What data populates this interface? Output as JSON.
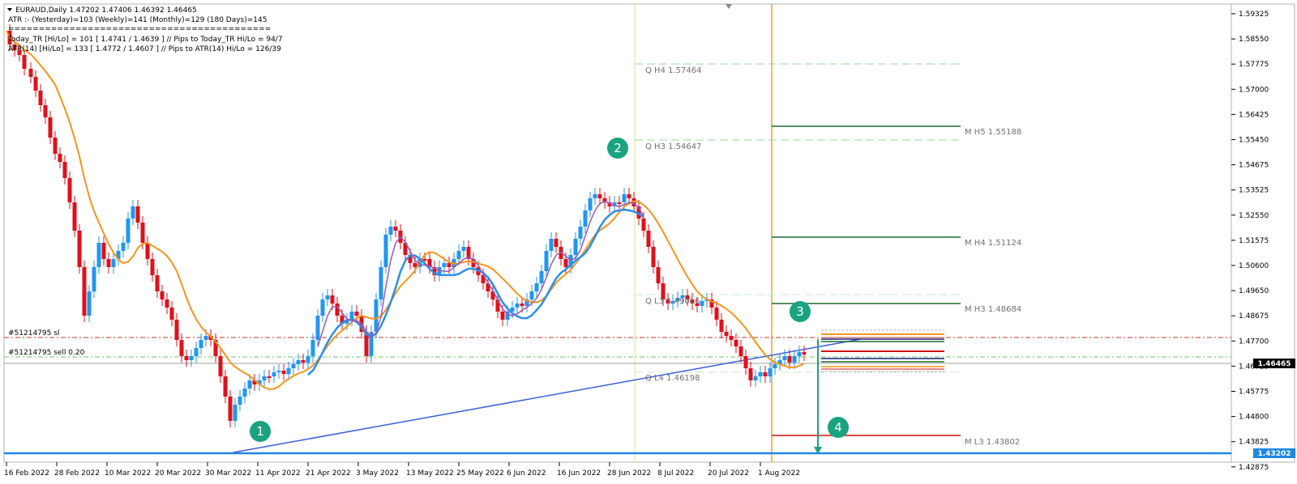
{
  "chart_header": {
    "symbol_line": "EURAUD,Daily  1.47202 1.47406 1.46392 1.46465",
    "atr_line": "ATR :- (Yesterday)=103      (Weekly)=141      (Monthly)=129      (180 Days)=145",
    "separator": "===========================================",
    "today_tr_line": "Today_TR [Hi/Lo] = 101 [ 1.4741 / 1.4639 ]  // Pips to Today_TR Hi/Lo  = 94/7",
    "atr14_line": "ATR(14)      [Hi/Lo] = 133 [ 1.4772 / 1.4607 ]  //  Pips to ATR(14) Hi/Lo      = 126/39"
  },
  "orders": {
    "sl_label": "#51214795 sl",
    "sell_label": "#51214795 sell 0.20"
  },
  "level_labels": {
    "q_h4": "Q  H4 1.57464",
    "q_h3": "Q  H3 1.54647",
    "q_l3": "Q  L3 1.49016",
    "q_l4": "Q  L4 1.46198",
    "m_h5": "M  H5 1.55188",
    "m_h4": "M  H4 1.51124",
    "m_h3": "M  H3 1.48684",
    "m_l3": "M  L3 1.43802"
  },
  "markers": [
    "1",
    "2",
    "3",
    "4"
  ],
  "price_axis": {
    "ticks": [
      "1.59325",
      "1.58550",
      "1.57775",
      "1.57000",
      "1.56425",
      "1.55450",
      "1.54675",
      "1.53525",
      "1.52550",
      "1.51575",
      "1.50600",
      "1.49650",
      "1.48675",
      "1.47700",
      "1.46725",
      "1.45775",
      "1.44800",
      "1.43825",
      "1.42875"
    ],
    "current_price": "1.46465",
    "support_price": "1.43202"
  },
  "time_axis": {
    "ticks": [
      "16 Feb 2022",
      "28 Feb 2022",
      "10 Mar 2022",
      "20 Mar 2022",
      "30 Mar 2022",
      "11 Apr 2022",
      "21 Apr 2022",
      "3 May 2022",
      "13 May 2022",
      "25 May 2022",
      "6 Jun 2022",
      "16 Jun 2022",
      "28 Jun 2022",
      "8 Jul 2022",
      "20 Jul 2022",
      "1 Aug 2022"
    ]
  },
  "colors": {
    "bull": "#2196f3",
    "bear": "#e0101a",
    "ma_fast": "#f7941d",
    "ma_blue": "#2b8fe6",
    "ma_purple": "#9b59b6",
    "marker": "#1aa37e",
    "support": "#1e88e5",
    "vline": "#f0a030",
    "m_level": "#1e6b2e",
    "q_level": "#8bd68b",
    "m_l3": "#d01010"
  }
}
